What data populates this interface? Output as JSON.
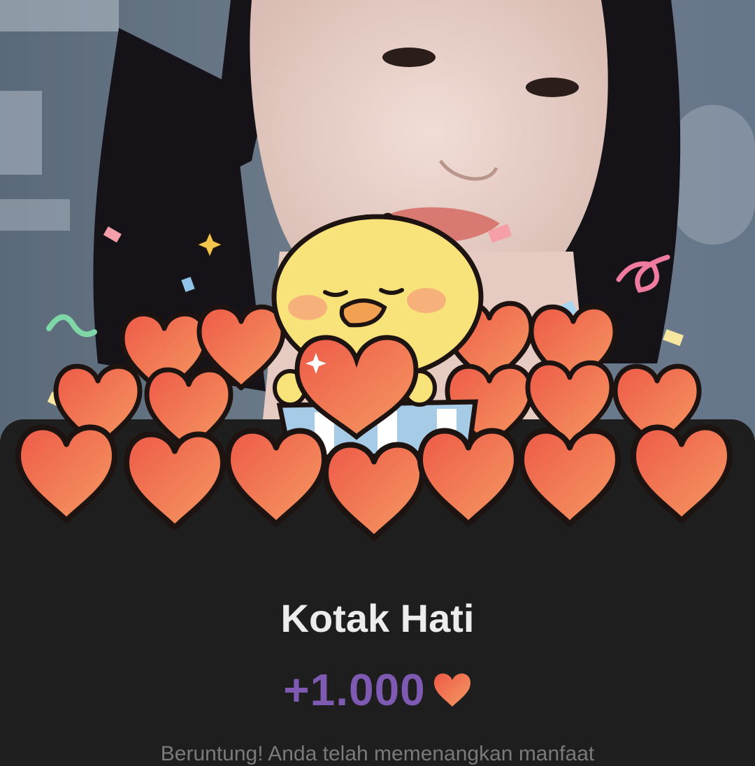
{
  "modal": {
    "title": "Kotak Hati",
    "reward_amount": "+1.000",
    "reward_icon": "heart-icon",
    "description": "Beruntung! Anda telah memenangkan manfaat"
  },
  "colors": {
    "background": "#1e1e1e",
    "title": "#ececec",
    "accent": "#7e5ab2",
    "heart": "#f26a50",
    "chick": "#f8e27a"
  }
}
